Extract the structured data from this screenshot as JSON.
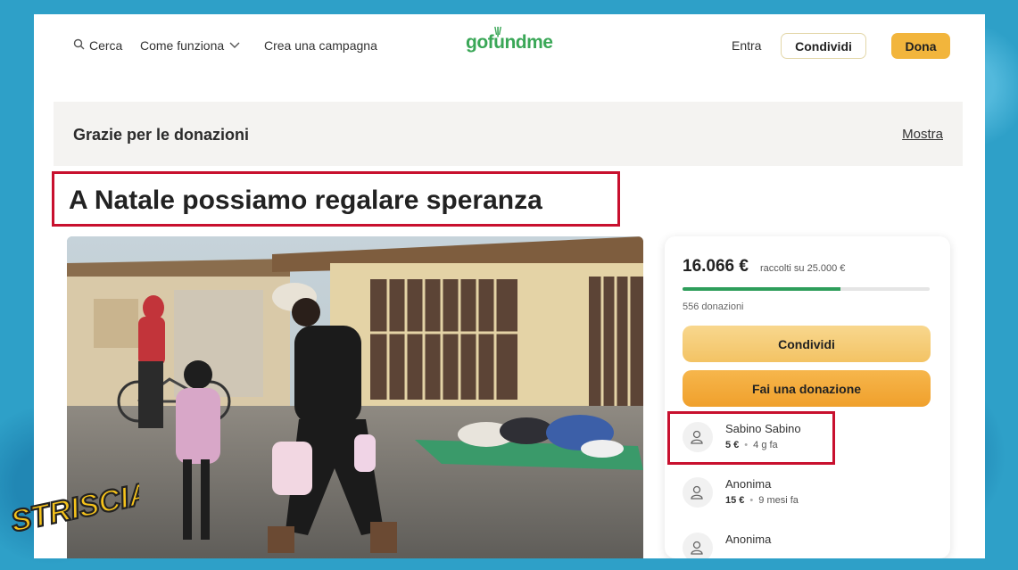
{
  "header": {
    "search_label": "Cerca",
    "how_it_works_label": "Come funziona",
    "create_campaign_label": "Crea una campagna",
    "logo_text": "gofundme",
    "login_label": "Entra",
    "share_label": "Condividi",
    "donate_label": "Dona"
  },
  "banner": {
    "text": "Grazie per le donazioni",
    "link": "Mostra"
  },
  "campaign": {
    "title": "A Natale possiamo regalare speranza"
  },
  "card": {
    "amount": "16.066 €",
    "goal": "raccolti su 25.000 €",
    "progress_fraction": 0.64,
    "donations_count": "556 donazioni",
    "share_button": "Condividi",
    "donate_button": "Fai una donazione",
    "donors": [
      {
        "name": "Sabino Sabino",
        "amount": "5 €",
        "when": "4 g fa"
      },
      {
        "name": "Anonima",
        "amount": "15 €",
        "when": "9 mesi fa"
      },
      {
        "name": "Anonima",
        "amount": "",
        "when": ""
      }
    ]
  },
  "overlay": {
    "logo_text": "STRISCIA"
  },
  "colors": {
    "brand_green": "#3aa757",
    "accent_yellow": "#f2b53c",
    "highlight_red": "#c8102e",
    "progress_green": "#2e9e5b"
  }
}
